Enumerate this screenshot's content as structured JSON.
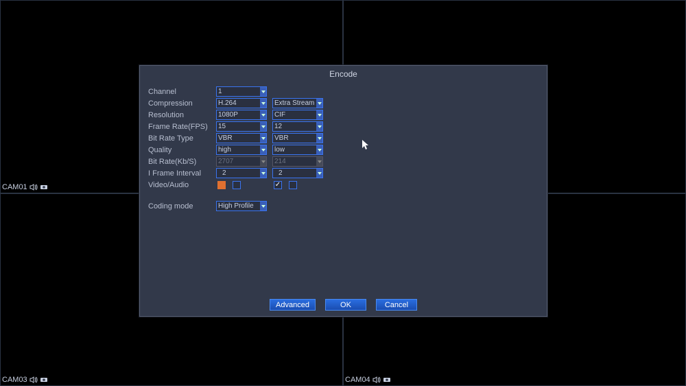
{
  "cams": [
    "CAM01",
    "",
    "CAM03",
    "CAM04"
  ],
  "dialog": {
    "title": "Encode",
    "labels": {
      "channel": "Channel",
      "compression": "Compression",
      "resolution": "Resolution",
      "framerate": "Frame Rate(FPS)",
      "bitratetype": "Bit Rate Type",
      "quality": "Quality",
      "bitrate": "Bit Rate(Kb/S)",
      "iframe": "I Frame Interval",
      "va": "Video/Audio",
      "coding": "Coding mode"
    },
    "main": {
      "channel": "1",
      "compression": "H.264",
      "resolution": "1080P",
      "framerate": "15",
      "bitratetype": "VBR",
      "quality": "high",
      "bitrate": "2707",
      "iframe": "2"
    },
    "extra": {
      "compression": "Extra Stream",
      "resolution": "CIF",
      "framerate": "12",
      "bitratetype": "VBR",
      "quality": "low",
      "bitrate": "214",
      "iframe": "2"
    },
    "coding": "High Profile",
    "buttons": {
      "advanced": "Advanced",
      "ok": "OK",
      "cancel": "Cancel"
    }
  }
}
